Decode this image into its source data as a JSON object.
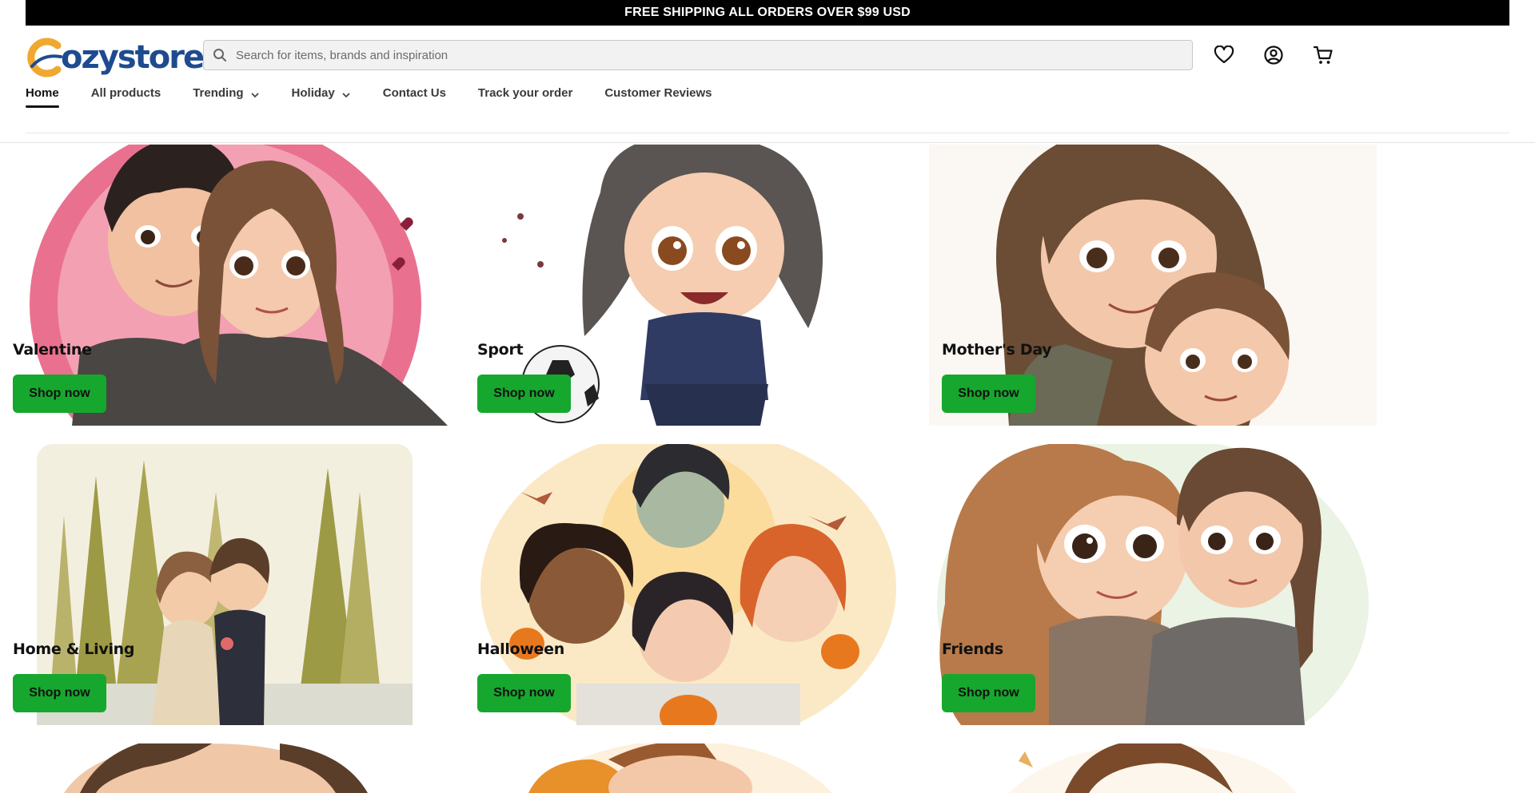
{
  "announcement": "FREE SHIPPING ALL ORDERS OVER $99 USD",
  "brand": {
    "logo_text": "ozystore",
    "logo_letter": "C",
    "color": "#1e4b8f",
    "accent": "#f0a830"
  },
  "search": {
    "placeholder": "Search for items, brands and inspiration",
    "value": ""
  },
  "header_icons": [
    "heart-icon",
    "account-icon",
    "cart-icon"
  ],
  "nav": [
    {
      "label": "Home",
      "active": true,
      "dropdown": false
    },
    {
      "label": "All products",
      "active": false,
      "dropdown": false
    },
    {
      "label": "Trending",
      "active": false,
      "dropdown": true
    },
    {
      "label": "Holiday",
      "active": false,
      "dropdown": true
    },
    {
      "label": "Contact Us",
      "active": false,
      "dropdown": false
    },
    {
      "label": "Track your order",
      "active": false,
      "dropdown": false
    },
    {
      "label": "Customer Reviews",
      "active": false,
      "dropdown": false
    }
  ],
  "categories": [
    {
      "title": "Valentine",
      "button": "Shop now"
    },
    {
      "title": "Sport",
      "button": "Shop now"
    },
    {
      "title": "Mother's Day",
      "button": "Shop now"
    },
    {
      "title": "Home & Living",
      "button": "Shop now"
    },
    {
      "title": "Halloween",
      "button": "Shop now"
    },
    {
      "title": "Friends",
      "button": "Shop now"
    }
  ],
  "colors": {
    "button_green": "#16a72e",
    "banner_black": "#000000"
  }
}
